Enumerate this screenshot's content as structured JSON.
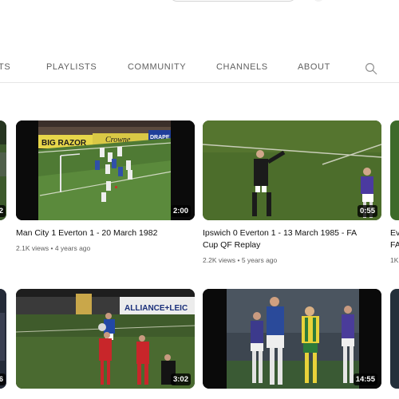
{
  "tabs": [
    {
      "label": "TS"
    },
    {
      "label": "PLAYLISTS"
    },
    {
      "label": "COMMUNITY"
    },
    {
      "label": "CHANNELS"
    },
    {
      "label": "ABOUT"
    }
  ],
  "icons": {
    "search": "search-icon"
  },
  "videos": {
    "row1": [
      {
        "duration": "2"
      },
      {
        "title_lines": [
          "Man City 1 Everton 1 - 20 March 1982"
        ],
        "views": "2.1K views",
        "age": "4 years ago",
        "duration": "2:00"
      },
      {
        "title_lines": [
          "Ipswich 0 Everton 1 - 13 March 1985 - FA",
          "Cup QF Replay"
        ],
        "views": "2.2K views",
        "age": "5 years ago",
        "duration": "0:55"
      },
      {
        "title_lines": [
          "Ev",
          "FA"
        ],
        "views": "1K"
      }
    ],
    "row2": [
      {
        "duration": "6"
      },
      {
        "duration": "3:02"
      },
      {
        "duration": "14:55"
      }
    ]
  },
  "meta_separator": "•",
  "thumbnail_text": {
    "v1_board_left": "BIG RAZOR",
    "v1_board_right": "DRAPE",
    "v1_board_mid": "Crowne",
    "v2_board": "ALLIANCE+LEIC"
  }
}
